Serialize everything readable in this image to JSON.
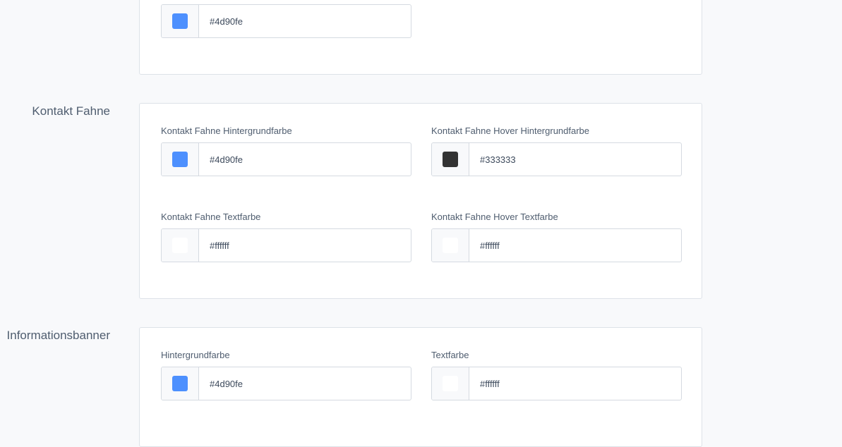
{
  "top_card": {
    "fields": [
      {
        "value": "#4d90fe",
        "swatch_color": "#4d90fe"
      }
    ]
  },
  "kontakt_fahne": {
    "title": "Kontakt Fahne",
    "fields": [
      {
        "label": "Kontakt Fahne Hintergrundfarbe",
        "value": "#4d90fe",
        "swatch_color": "#4d90fe"
      },
      {
        "label": "Kontakt Fahne Hover Hintergrundfarbe",
        "value": "#333333",
        "swatch_color": "#333333"
      },
      {
        "label": "Kontakt Fahne Textfarbe",
        "value": "#ffffff",
        "swatch_color": "#ffffff"
      },
      {
        "label": "Kontakt Fahne Hover Textfarbe",
        "value": "#ffffff",
        "swatch_color": "#ffffff"
      }
    ]
  },
  "informationsbanner": {
    "title": "Informationsbanner",
    "fields": [
      {
        "label": "Hintergrundfarbe",
        "value": "#4d90fe",
        "swatch_color": "#4d90fe"
      },
      {
        "label": "Textfarbe",
        "value": "#ffffff",
        "swatch_color": "#ffffff"
      }
    ]
  }
}
